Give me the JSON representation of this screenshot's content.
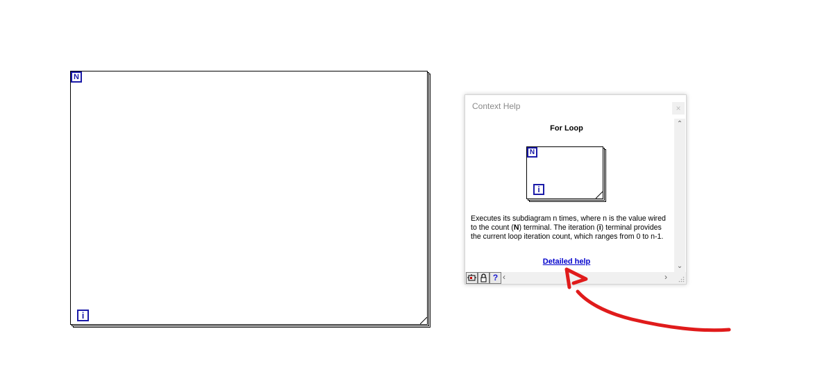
{
  "block_diagram": {
    "for_loop": {
      "count_terminal": "N",
      "iteration_terminal": "i"
    }
  },
  "context_help": {
    "title": "Context Help",
    "close_glyph": "×",
    "heading": "For Loop",
    "icon": {
      "count_terminal": "N",
      "iteration_terminal": "i"
    },
    "description": {
      "part1": "Executes its subdiagram n times, where n is the value wired to the count (",
      "count_term": "N",
      "part2": ") terminal. The iteration (",
      "iter_term": "i",
      "part3": ") terminal provides the current loop iteration count, which ranges from 0 to n-1."
    },
    "link": "Detailed help",
    "scroll_up": "⌃",
    "scroll_down": "⌄",
    "scroll_left": "‹",
    "scroll_right": "›",
    "toolbar": {
      "simple_help_icon": "simple-help-icon",
      "lock_icon": "lock-icon",
      "help_label": "?"
    }
  },
  "annotation": {
    "color": "#e01b1b"
  }
}
